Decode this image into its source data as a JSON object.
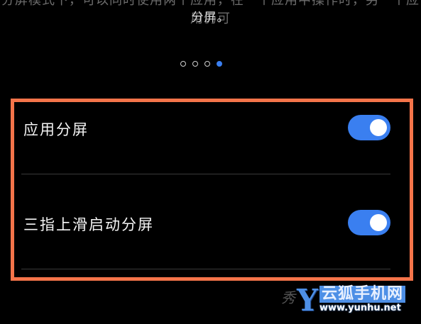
{
  "description": {
    "line1": "分屏模式下，可以同时使用两个应用，在一个应用中操作时，另一个应用仍可",
    "line2": "分屏。"
  },
  "pager": {
    "total": 4,
    "active_index": 3,
    "active_color": "#3a7ff0"
  },
  "settings": {
    "items": [
      {
        "label": "应用分屏",
        "enabled": true
      },
      {
        "label": "三指上滑启动分屏",
        "enabled": true
      }
    ]
  },
  "highlight": {
    "color": "#f4744a"
  },
  "watermark": {
    "logo": "Y",
    "title": "云狐手机网",
    "url": "www.yunhu.net",
    "ghost": "秀"
  },
  "colors": {
    "background": "#000000",
    "toggle_on": "#3a7ff0",
    "divider": "#3a3a3a"
  }
}
